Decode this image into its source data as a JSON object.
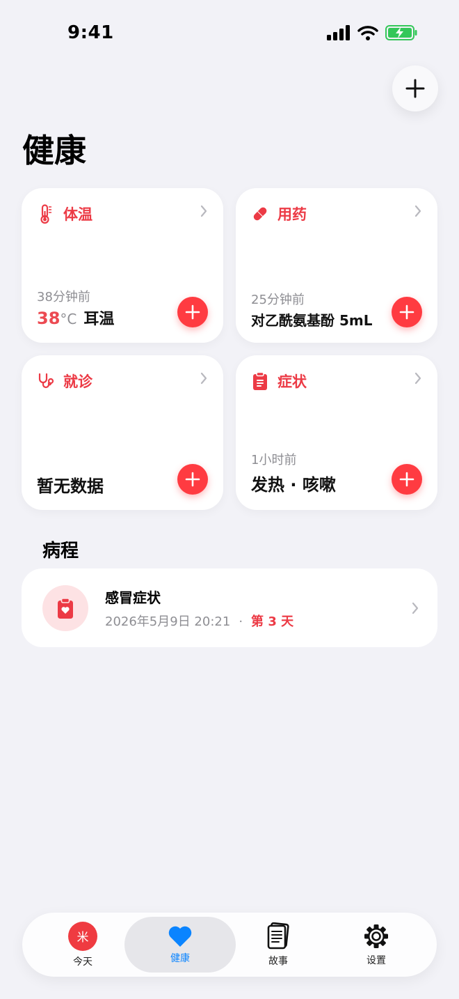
{
  "status_bar": {
    "time": "9:41"
  },
  "page": {
    "title": "健康"
  },
  "cards": [
    {
      "title": "体温",
      "icon": "thermometer-icon",
      "time": "38分钟前",
      "value_number": "38",
      "value_unit": "°C",
      "value_text": "耳温"
    },
    {
      "title": "用药",
      "icon": "pill-icon",
      "time": "25分钟前",
      "value_text": "对乙酰氨基酚 5mL"
    },
    {
      "title": "就诊",
      "icon": "stethoscope-icon",
      "value_text": "暂无数据"
    },
    {
      "title": "症状",
      "icon": "clipboard-icon",
      "time": "1小时前",
      "value_text": "发热 · 咳嗽"
    }
  ],
  "course": {
    "section_title": "病程",
    "title": "感冒症状",
    "date": "2026年5月9日 20:21",
    "separator": "·",
    "day": "第 3 天"
  },
  "tabs": [
    {
      "label": "今天",
      "badge": "米",
      "icon": "today-badge-icon"
    },
    {
      "label": "健康",
      "icon": "heart-icon",
      "selected": true
    },
    {
      "label": "故事",
      "icon": "book-icon"
    },
    {
      "label": "设置",
      "icon": "gear-icon"
    }
  ],
  "colors": {
    "accent": "#ec3a45",
    "tab_selected": "#0a84ff",
    "background": "#f2f2f7"
  }
}
